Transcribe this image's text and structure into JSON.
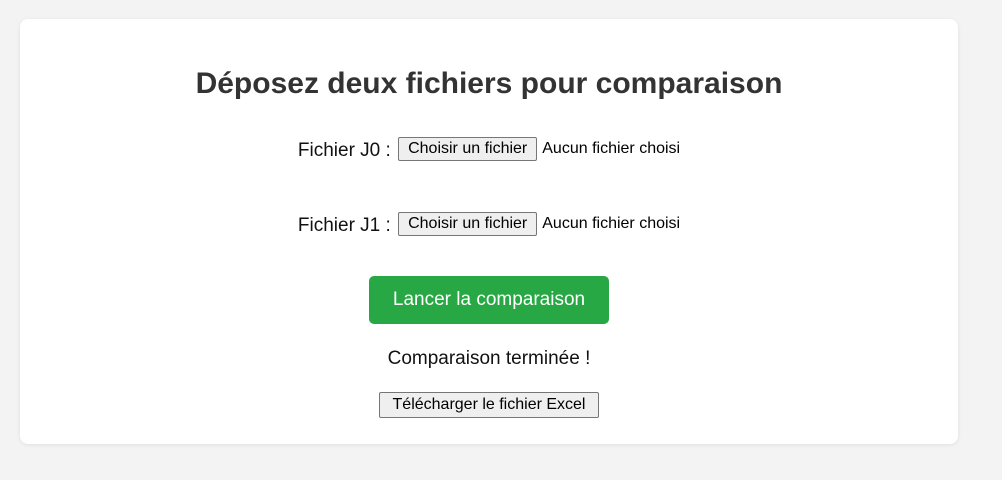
{
  "form": {
    "title": "Déposez deux fichiers pour comparaison",
    "file_j0": {
      "label": "Fichier J0",
      "separator": ":",
      "button_label": "Choisir un fichier",
      "status": "Aucun fichier choisi"
    },
    "file_j1": {
      "label": "Fichier J1",
      "separator": ":",
      "button_label": "Choisir un fichier",
      "status": "Aucun fichier choisi"
    },
    "submit_label": "Lancer la comparaison",
    "result_message": "Comparaison terminée !",
    "download_label": "Télécharger le fichier Excel"
  },
  "colors": {
    "page_background": "#f3f3f3",
    "card_background": "#ffffff",
    "primary_button": "#28a745",
    "title_text": "#333333"
  }
}
